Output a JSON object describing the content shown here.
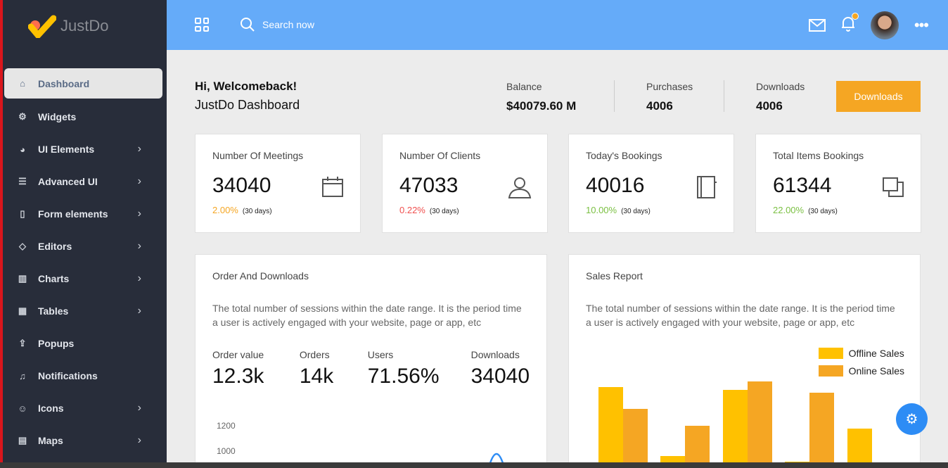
{
  "brand": {
    "name": "JustDo"
  },
  "sidebar": {
    "items": [
      {
        "label": "Dashboard",
        "icon": "home-icon",
        "glyph": "⌂",
        "active": true,
        "chevron": false
      },
      {
        "label": "Widgets",
        "icon": "gear-icon",
        "glyph": "⚙",
        "chevron": false
      },
      {
        "label": "UI Elements",
        "icon": "palette-icon",
        "glyph": "◕",
        "chevron": true
      },
      {
        "label": "Advanced UI",
        "icon": "layers-icon",
        "glyph": "☰",
        "chevron": true
      },
      {
        "label": "Form elements",
        "icon": "clipboard-icon",
        "glyph": "▯",
        "chevron": true
      },
      {
        "label": "Editors",
        "icon": "eraser-icon",
        "glyph": "◇",
        "chevron": true
      },
      {
        "label": "Charts",
        "icon": "bar-chart-icon",
        "glyph": "▥",
        "chevron": true
      },
      {
        "label": "Tables",
        "icon": "table-icon",
        "glyph": "▦",
        "chevron": true
      },
      {
        "label": "Popups",
        "icon": "upload-icon",
        "glyph": "⇪",
        "chevron": false
      },
      {
        "label": "Notifications",
        "icon": "bell-icon",
        "glyph": "♫",
        "chevron": false
      },
      {
        "label": "Icons",
        "icon": "smile-icon",
        "glyph": "☺",
        "chevron": true
      },
      {
        "label": "Maps",
        "icon": "map-icon",
        "glyph": "▤",
        "chevron": true
      }
    ]
  },
  "header": {
    "search_label": "Search now",
    "bg": "#65abf9"
  },
  "welcome": {
    "title": "Hi, Welcomeback!",
    "subtitle": "JustDo Dashboard"
  },
  "stats": [
    {
      "label": "Balance",
      "value": "$40079.60 M"
    },
    {
      "label": "Purchases",
      "value": "4006"
    },
    {
      "label": "Downloads",
      "value": "4006"
    }
  ],
  "downloads_button": "Downloads",
  "kpis": [
    {
      "label": "Number Of Meetings",
      "value": "34040",
      "pct": "2.00%",
      "period": "(30 days)",
      "color": "#f5a623",
      "icon": "calendar-icon"
    },
    {
      "label": "Number Of Clients",
      "value": "47033",
      "pct": "0.22%",
      "period": "(30 days)",
      "color": "#f0504f",
      "icon": "user-icon"
    },
    {
      "label": "Today's Bookings",
      "value": "40016",
      "pct": "10.00%",
      "period": "(30 days)",
      "color": "#7bc043",
      "icon": "notebook-icon"
    },
    {
      "label": "Total Items Bookings",
      "value": "61344",
      "pct": "22.00%",
      "period": "(30 days)",
      "color": "#7bc043",
      "icon": "copy-icon"
    }
  ],
  "orders": {
    "title": "Order And Downloads",
    "desc": "The total number of sessions within the date range. It is the period time a user is actively engaged with your website, page or app, etc",
    "metrics": [
      {
        "label": "Order value",
        "value": "12.3k"
      },
      {
        "label": "Orders",
        "value": "14k"
      },
      {
        "label": "Users",
        "value": "71.56%"
      },
      {
        "label": "Downloads",
        "value": "34040"
      }
    ],
    "yticks": [
      "1200",
      "1000"
    ]
  },
  "sales": {
    "title": "Sales Report",
    "desc": "The total number of sessions within the date range. It is the period time a user is actively engaged with your website, page or app, etc",
    "chart_data": {
      "type": "bar",
      "series": [
        {
          "name": "Offline Sales",
          "color": "#ffc100",
          "values": [
            149,
            51,
            145,
            43,
            90
          ]
        },
        {
          "name": "Online Sales",
          "color": "#f5a623",
          "values": [
            118,
            94,
            157,
            141,
            null
          ]
        }
      ],
      "legend": "top-right"
    }
  }
}
